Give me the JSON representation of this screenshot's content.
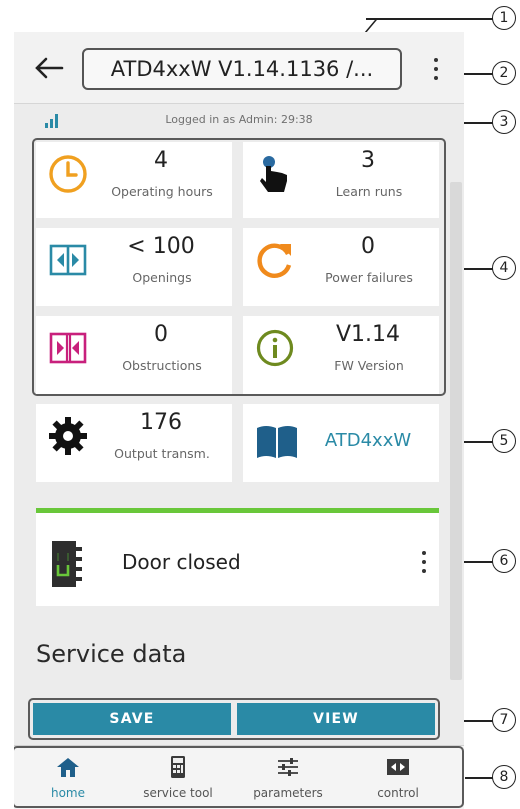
{
  "header": {
    "title": "ATD4xxW V1.14.1136 /...",
    "status": "Logged in as Admin: 29:38"
  },
  "tiles": [
    {
      "value": "4",
      "label": "Operating hours",
      "icon": "clock-icon"
    },
    {
      "value": "3",
      "label": "Learn runs",
      "icon": "hand-pointer-icon"
    },
    {
      "value": "< 100",
      "label": "Openings",
      "icon": "door-open-icon"
    },
    {
      "value": "0",
      "label": "Power failures",
      "icon": "refresh-icon"
    },
    {
      "value": "0",
      "label": "Obstructions",
      "icon": "obstruction-icon"
    },
    {
      "value": "V1.14",
      "label": "FW Version",
      "icon": "info-icon"
    },
    {
      "value": "176",
      "label": "Output transm.",
      "icon": "gear-icon"
    },
    {
      "value": "ATD4xxW",
      "label": "",
      "icon": "book-icon"
    }
  ],
  "door_status": {
    "text": "Door closed",
    "indicator_color": "#69c73a"
  },
  "section_title": "Service data",
  "buttons": {
    "save": "SAVE",
    "view": "VIEW"
  },
  "nav": [
    {
      "label": "home",
      "icon": "home-icon",
      "active": true
    },
    {
      "label": "service tool",
      "icon": "calculator-icon",
      "active": false
    },
    {
      "label": "parameters",
      "icon": "sliders-icon",
      "active": false
    },
    {
      "label": "control",
      "icon": "door-control-icon",
      "active": false
    }
  ],
  "callouts": [
    "1",
    "2",
    "3",
    "4",
    "5",
    "6",
    "7",
    "8"
  ],
  "colors": {
    "accent": "#2a8aa6",
    "orange": "#f08a1c",
    "magenta": "#c8207c",
    "olive": "#6e8a1f",
    "green": "#69c73a"
  }
}
